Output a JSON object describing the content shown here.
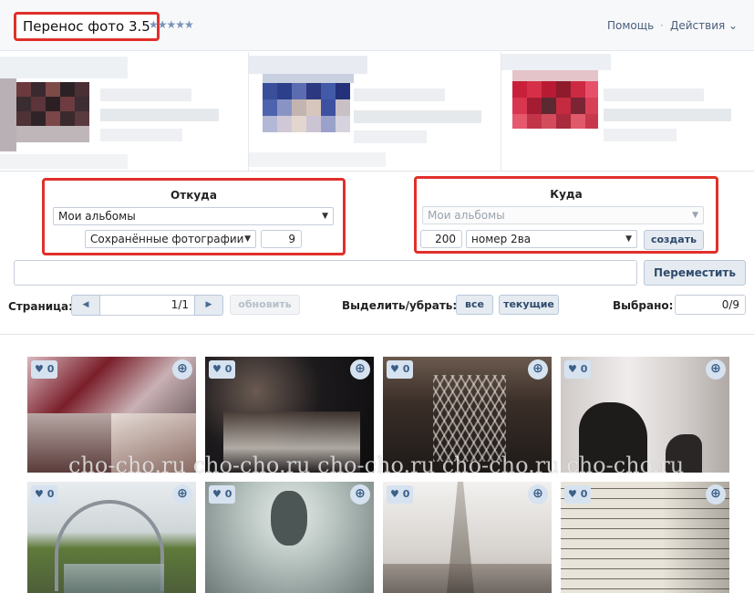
{
  "header": {
    "app_title": "Перенос фото 3.5",
    "rating_stars": "★★★★★",
    "help_label": "Помощь",
    "separator": "·",
    "actions_label": "Действия ⌄"
  },
  "source": {
    "title": "Откуда",
    "album_select": "Мои альбомы",
    "folder_select": "Сохранённые фотографии",
    "count": "9"
  },
  "target": {
    "title": "Куда",
    "album_select": "Мои альбомы",
    "count": "200",
    "album_name_select": "номер 2ва",
    "create_label": "создать"
  },
  "move": {
    "input_value": "",
    "button_label": "Переместить"
  },
  "pager": {
    "label": "Страница:",
    "prev_icon": "◀",
    "next_icon": "▶",
    "value": "1/1",
    "refresh_label": "обновить"
  },
  "selection": {
    "label": "Выделить/убрать:",
    "all_label": "все",
    "current_label": "текущие",
    "selected_label": "Выбрано:",
    "selected_value": "0/9"
  },
  "photos": {
    "like_icon": "♥",
    "zoom_icon": "⊕",
    "items": [
      {
        "likes": "0"
      },
      {
        "likes": "0"
      },
      {
        "likes": "0"
      },
      {
        "likes": "0"
      },
      {
        "likes": "0"
      },
      {
        "likes": "0"
      },
      {
        "likes": "0"
      },
      {
        "likes": "0"
      }
    ]
  },
  "watermark": "cho-cho.ru cho-cho.ru cho-cho.ru cho-cho.ru cho-cho.ru",
  "colors": {
    "highlight": "#e0302b",
    "accent": "#2f4a6b",
    "button_bg": "#e5ebf1",
    "like_bg": "#d6e2ef"
  }
}
